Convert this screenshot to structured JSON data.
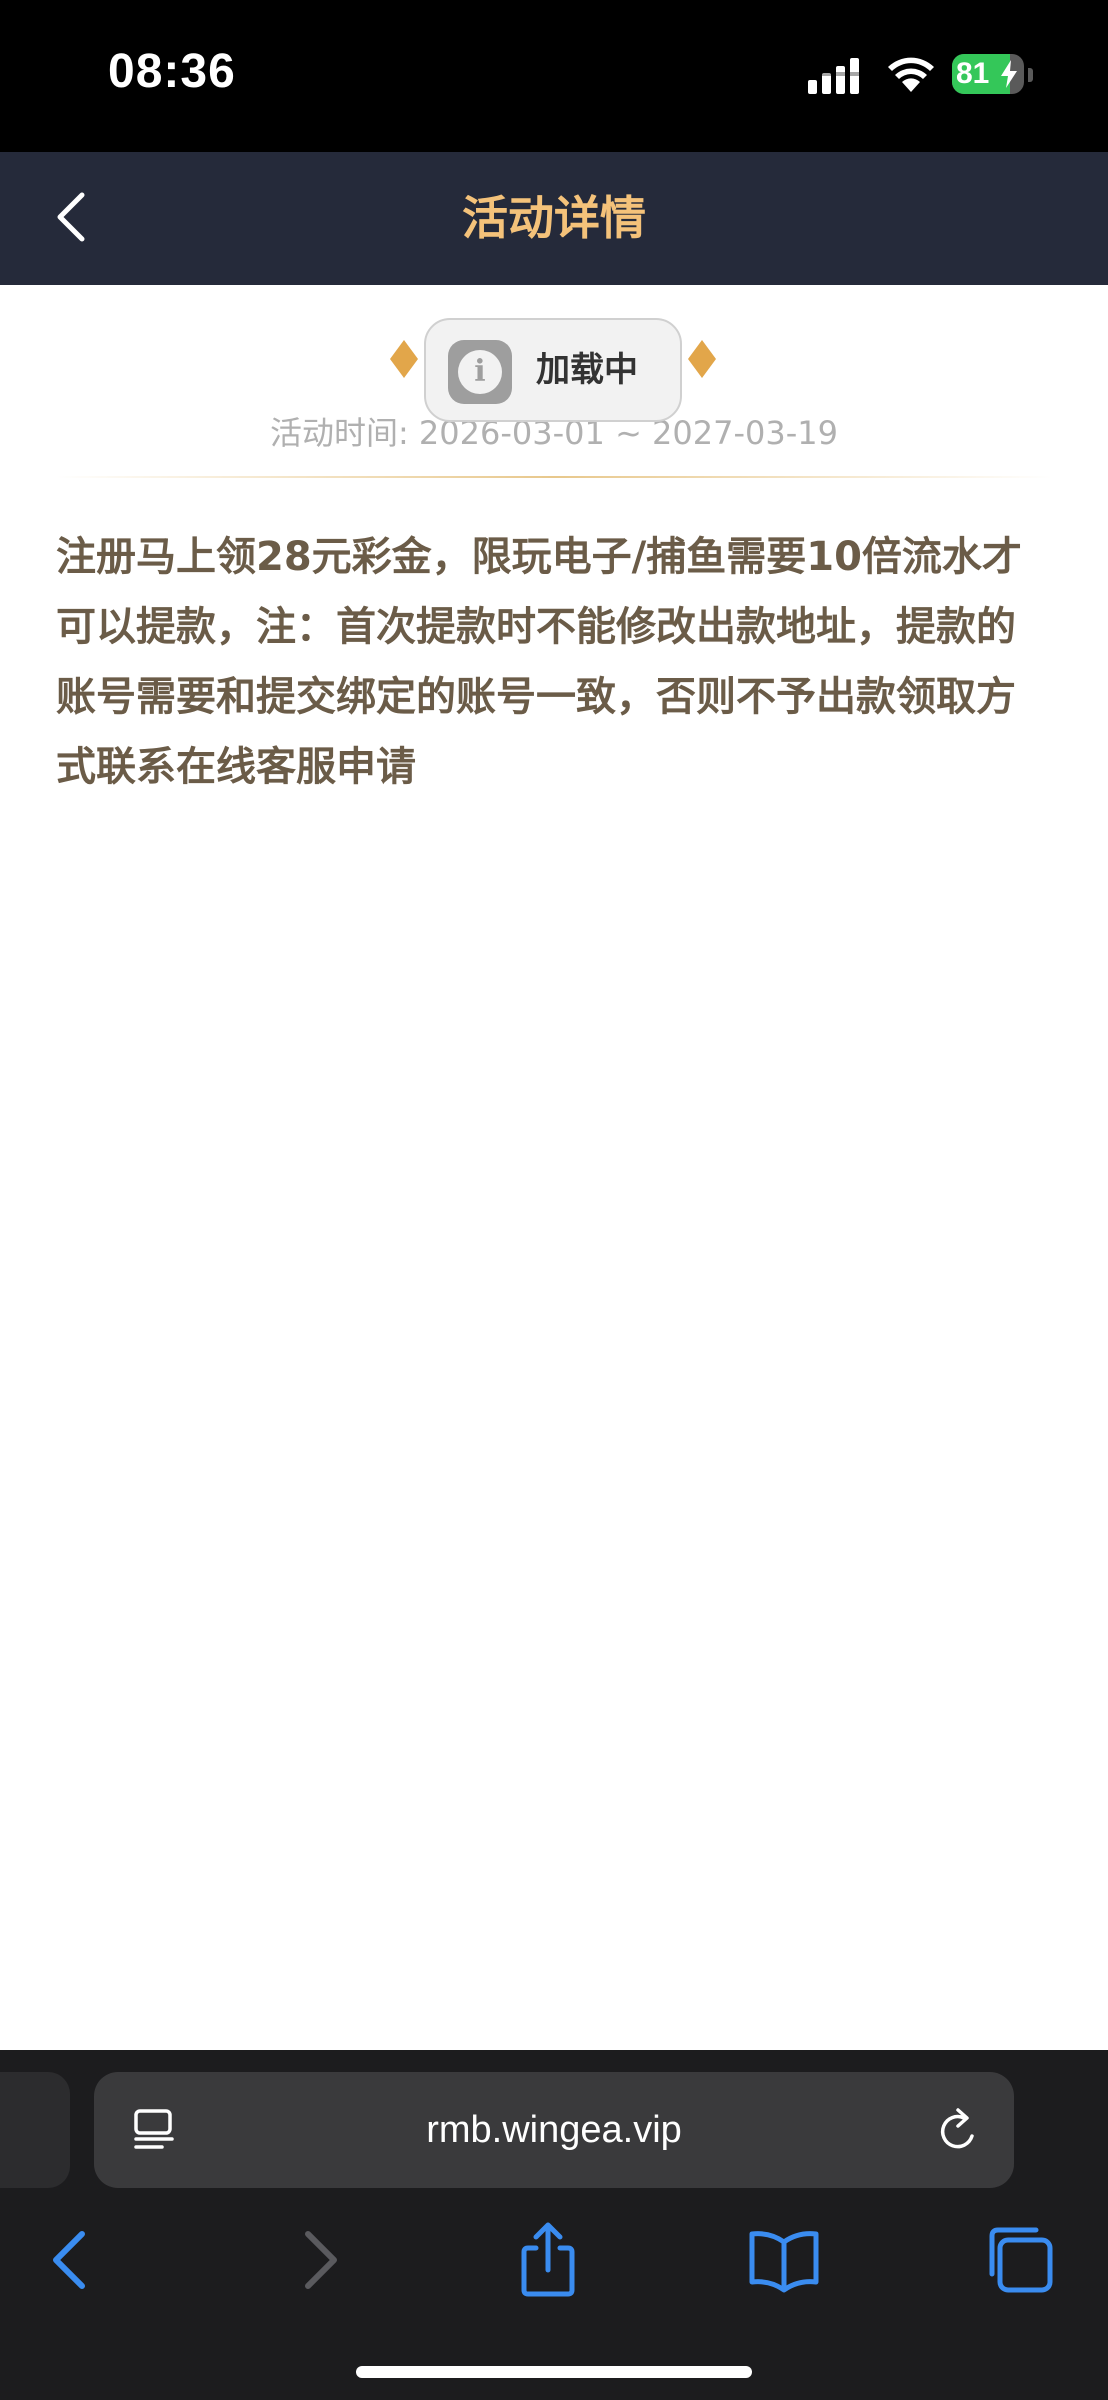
{
  "status_bar": {
    "time": "08:36",
    "battery_percent": 81,
    "battery_label": "81",
    "icons": [
      "signal-icon",
      "wifi-icon",
      "battery-icon",
      "charging-bolt-icon"
    ]
  },
  "header": {
    "title": "活动详情",
    "back_icon": "chevron-left-icon",
    "title_color": "#f4c27a",
    "background": "#252a3a"
  },
  "toast": {
    "text": "加载中",
    "icon": "info-icon"
  },
  "activity": {
    "time": "活动时间: 2026-03-01 ~ 2027-03-19",
    "description": "注册马上领28元彩金，限玩电子/捕鱼需要10倍流水才可以提款，注：首次提款时不能修改出款地址，提款的账号需要和提交绑定的账号一致，否则不予出款领取方式联系在线客服申请",
    "accent_color": "#e2a64a"
  },
  "browser": {
    "url": "rmb.wingea.vip",
    "address_icons": [
      "reader-icon",
      "reload-icon"
    ],
    "toolbar": [
      "back-arrow-icon",
      "forward-arrow-icon",
      "share-icon",
      "bookmarks-icon",
      "tabs-icon"
    ],
    "link_color": "#3a8cf0"
  }
}
